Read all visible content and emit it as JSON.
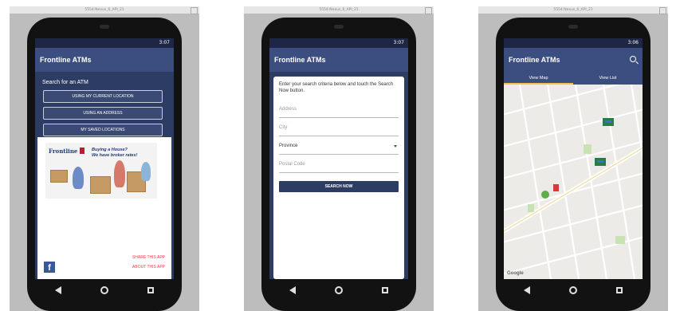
{
  "device_title": "5554:Nexus_6_API_21",
  "screens": [
    {
      "status_time": "3:07",
      "app_title": "Frontline ATMs",
      "heading": "Search for an ATM",
      "buttons": [
        "USING MY CURRENT LOCATION",
        "USING AN ADDRESS",
        "MY SAVED LOCATIONS"
      ],
      "ad": {
        "brand": "Frontline",
        "tagline_line1": "Buying a House?",
        "tagline_line2": "We have broker rates!"
      },
      "facebook_glyph": "f",
      "links": [
        "SHARE THIS APP",
        "ABOUT THIS APP"
      ]
    },
    {
      "status_time": "3:07",
      "app_title": "Frontline ATMs",
      "intro": "Enter your search criteria below and touch the Search Now button.",
      "fields": {
        "address_placeholder": "Address",
        "city_placeholder": "City",
        "province_value": "Province",
        "postal_placeholder": "Postal Code"
      },
      "search_button": "SEARCH NOW"
    },
    {
      "status_time": "3:06",
      "app_title": "Frontline ATMs",
      "tabs": [
        "View Map",
        "View List"
      ],
      "active_tab": "View Map",
      "map_attribution": "Google"
    }
  ],
  "colors": {
    "primary": "#3c4e80",
    "primary_dark": "#2d3c63",
    "accent_tab": "#f5c04a",
    "link_red": "#e74040"
  },
  "icons": {
    "search": "search-icon",
    "back": "back-icon",
    "home": "home-icon",
    "recents": "recents-icon"
  }
}
